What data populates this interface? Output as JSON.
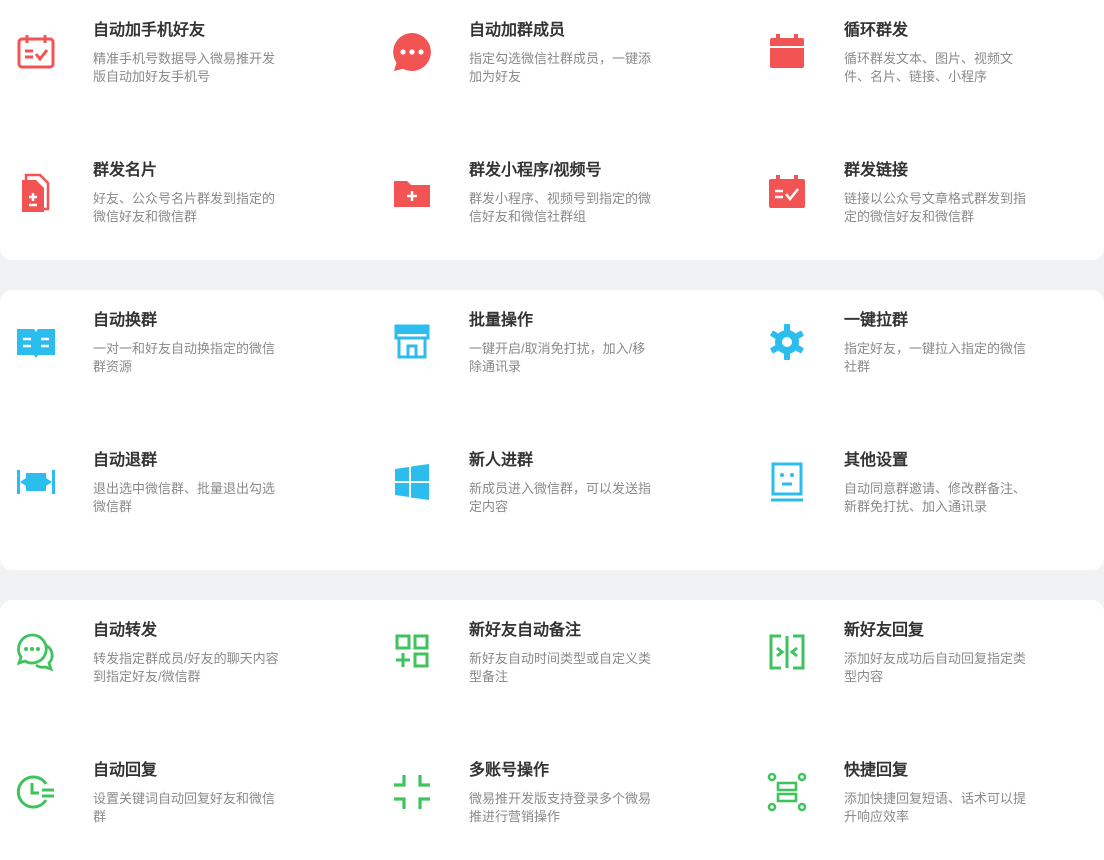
{
  "colors": {
    "red": "#f25353",
    "blue": "#2bbdee",
    "green": "#3fc35d"
  },
  "groups": [
    {
      "features": [
        {
          "icon": "calendar-check-icon",
          "title": "自动加手机好友",
          "desc": "精准手机号数据导入微易推开发版自动加好友手机号"
        },
        {
          "icon": "chat-dots-icon",
          "title": "自动加群成员",
          "desc": "指定勾选微信社群成员，一键添加为好友"
        },
        {
          "icon": "calendar-icon",
          "title": "循环群发",
          "desc": "循环群发文本、图片、视频文件、名片、链接、小程序"
        },
        {
          "icon": "document-plus-minus-icon",
          "title": "群发名片",
          "desc": "好友、公众号名片群发到指定的微信好友和微信群"
        },
        {
          "icon": "folder-plus-icon",
          "title": "群发小程序/视频号",
          "desc": "群发小程序、视频号到指定的微信好友和微信社群组"
        },
        {
          "icon": "calendar-check-icon",
          "title": "群发链接",
          "desc": "链接以公众号文章格式群发到指定的微信好友和微信群"
        }
      ]
    },
    {
      "features": [
        {
          "icon": "open-book-icon",
          "title": "自动换群",
          "desc": "一对一和好友自动换指定的微信群资源"
        },
        {
          "icon": "storefront-icon",
          "title": "批量操作",
          "desc": "一键开启/取消免打扰，加入/移除通讯录"
        },
        {
          "icon": "gear-icon",
          "title": "一键拉群",
          "desc": "指定好友，一键拉入指定的微信社群"
        },
        {
          "icon": "exit-bar-icon",
          "title": "自动退群",
          "desc": "退出选中微信群、批量退出勾选微信群"
        },
        {
          "icon": "windows-icon",
          "title": "新人进群",
          "desc": "新成员进入微信群，可以发送指定内容"
        },
        {
          "icon": "monitor-face-icon",
          "title": "其他设置",
          "desc": "自动同意群邀请、修改群备注、新群免打扰、加入通讯录"
        }
      ]
    },
    {
      "features": [
        {
          "icon": "chat-bubbles-icon",
          "title": "自动转发",
          "desc": "转发指定群成员/好友的聊天内容到指定好友/微信群"
        },
        {
          "icon": "grid-add-icon",
          "title": "新好友自动备注",
          "desc": "新好友自动时间类型或自定义类型备注"
        },
        {
          "icon": "merge-arrows-icon",
          "title": "新好友回复",
          "desc": "添加好友成功后自动回复指定类型内容"
        },
        {
          "icon": "clock-list-icon",
          "title": "自动回复",
          "desc": "设置关键词自动回复好友和微信群"
        },
        {
          "icon": "compress-corners-icon",
          "title": "多账号操作",
          "desc": "微易推开发版支持登录多个微易推进行营销操作"
        },
        {
          "icon": "scan-frame-icon",
          "title": "快捷回复",
          "desc": "添加快捷回复短语、话术可以提升响应效率"
        }
      ]
    }
  ]
}
